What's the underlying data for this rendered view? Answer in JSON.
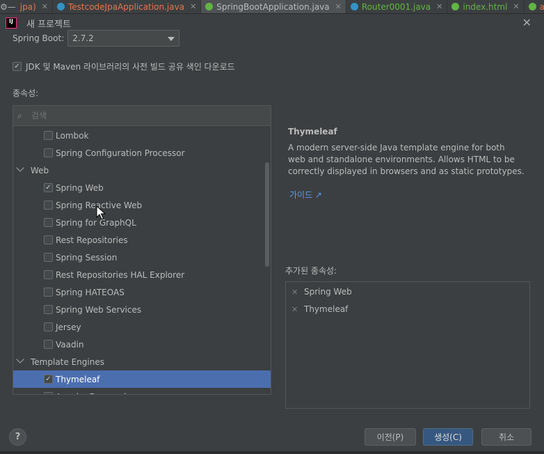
{
  "tabs": [
    {
      "label": "jpa)",
      "color": "#e8754a",
      "icon": "",
      "active": false
    },
    {
      "label": "TestcodeJpaApplication.java",
      "color": "#e8754a",
      "icon": "#3592c4",
      "active": false
    },
    {
      "label": "SpringBootApplication.java",
      "color": "#bbbbbb",
      "icon": "#62b543",
      "active": true
    },
    {
      "label": "Router0001.java",
      "color": "#62b543",
      "icon": "#3592c4",
      "active": false
    },
    {
      "label": "index.html",
      "color": "#62b543",
      "icon": "#62b543",
      "active": false
    },
    {
      "label": "app",
      "color": "#e8754a",
      "icon": "#62b543",
      "active": false
    }
  ],
  "dialog": {
    "title": "새 프로젝트",
    "app_icon_text": "IJ"
  },
  "spring_boot": {
    "label": "Spring Boot:",
    "version": "2.7.2"
  },
  "jdk_option": {
    "label": "JDK 및 Maven 라이브러리의 사전 빌드 공유 색인 다운로드",
    "checked": true
  },
  "dependencies": {
    "label": "종속성:",
    "search_placeholder": "검색",
    "tree": [
      {
        "type": "item",
        "label": "Lombok",
        "checked": false
      },
      {
        "type": "item",
        "label": "Spring Configuration Processor",
        "checked": false
      },
      {
        "type": "group",
        "label": "Web"
      },
      {
        "type": "item",
        "label": "Spring Web",
        "checked": true
      },
      {
        "type": "item",
        "label": "Spring Reactive Web",
        "checked": false
      },
      {
        "type": "item",
        "label": "Spring for GraphQL",
        "checked": false
      },
      {
        "type": "item",
        "label": "Rest Repositories",
        "checked": false
      },
      {
        "type": "item",
        "label": "Spring Session",
        "checked": false
      },
      {
        "type": "item",
        "label": "Rest Repositories HAL Explorer",
        "checked": false
      },
      {
        "type": "item",
        "label": "Spring HATEOAS",
        "checked": false
      },
      {
        "type": "item",
        "label": "Spring Web Services",
        "checked": false
      },
      {
        "type": "item",
        "label": "Jersey",
        "checked": false
      },
      {
        "type": "item",
        "label": "Vaadin",
        "checked": false
      },
      {
        "type": "group",
        "label": "Template Engines"
      },
      {
        "type": "item",
        "label": "Thymeleaf",
        "checked": true,
        "selected": true
      },
      {
        "type": "item",
        "label": "Apache Freemarker",
        "checked": false
      }
    ]
  },
  "detail": {
    "title": "Thymeleaf",
    "description": "A modern server-side Java template engine for both web and standalone environments. Allows HTML to be correctly displayed in browsers and as static prototypes.",
    "guide_link": "가이드 ↗"
  },
  "added": {
    "label": "추가된 종속성:",
    "items": [
      "Spring Web",
      "Thymeleaf"
    ]
  },
  "buttons": {
    "help": "?",
    "previous": "이전(P)",
    "create": "생성(C)",
    "cancel": "취소"
  }
}
